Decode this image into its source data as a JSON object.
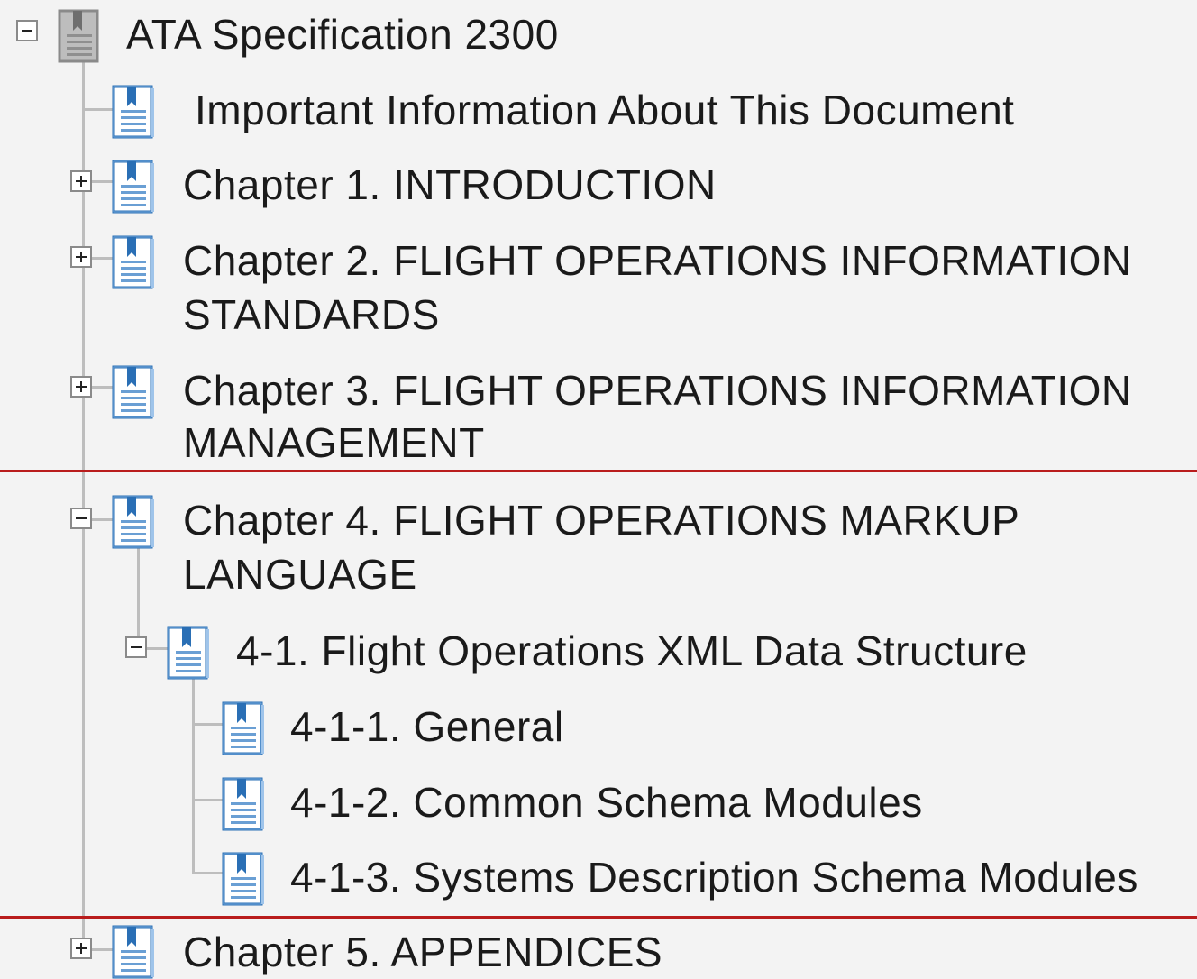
{
  "tree": {
    "root": {
      "label": "ATA Specification 2300",
      "icon": "book-icon",
      "expanded": true
    },
    "items": [
      {
        "label": "Important Information About This Document",
        "icon": "document-icon"
      },
      {
        "label": "Chapter 1. INTRODUCTION",
        "icon": "document-icon",
        "expanded": false
      },
      {
        "label_line1": "Chapter 2.  FLIGHT OPERATIONS INFORMATION",
        "label_line2": "STANDARDS",
        "icon": "document-icon",
        "expanded": false
      },
      {
        "label_line1": "Chapter 3.  FLIGHT OPERATIONS INFORMATION",
        "label_line2": "MANAGEMENT",
        "icon": "document-icon",
        "expanded": false
      },
      {
        "label_line1": "Chapter 4.  FLIGHT OPERATIONS MARKUP",
        "label_line2": "LANGUAGE",
        "icon": "document-icon",
        "expanded": true
      },
      {
        "label": "4-1. Flight Operations XML Data Structure",
        "icon": "document-icon",
        "expanded": true
      },
      {
        "label": "4-1-1. General",
        "icon": "document-icon"
      },
      {
        "label": "4-1-2. Common Schema Modules",
        "icon": "document-icon"
      },
      {
        "label": "4-1-3. Systems Description Schema Modules",
        "icon": "document-icon"
      },
      {
        "label": "Chapter 5.  APPENDICES",
        "icon": "document-icon",
        "expanded": false
      }
    ]
  },
  "colors": {
    "background": "#f3f3f3",
    "highlight_border": "#b91c1c",
    "tree_lines": "#bdbdbd",
    "icon_blue": "#2a6fb5"
  }
}
